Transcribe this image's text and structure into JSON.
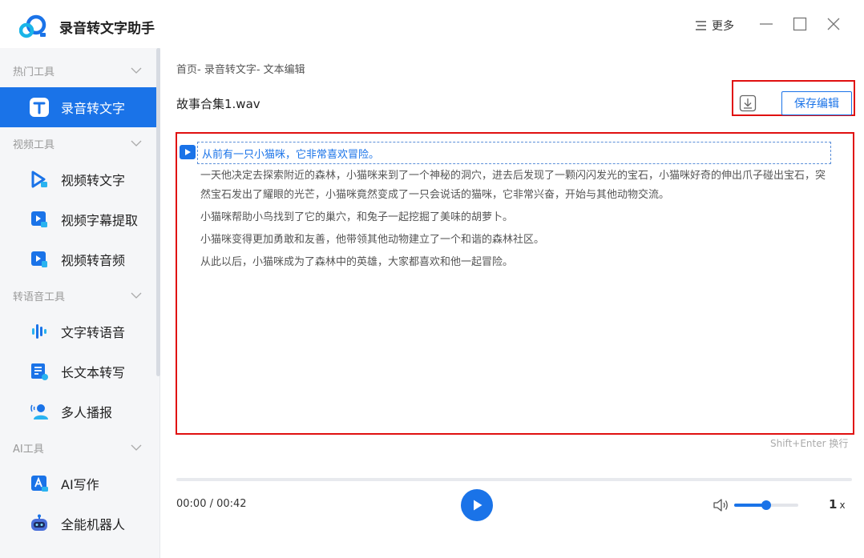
{
  "app": {
    "title": "录音转文字助手",
    "more_label": "更多"
  },
  "sidebar": {
    "sections": [
      {
        "label": "热门工具",
        "items": [
          {
            "label": "录音转文字",
            "icon": "text-t-icon",
            "active": true
          }
        ]
      },
      {
        "label": "视频工具",
        "items": [
          {
            "label": "视频转文字",
            "icon": "video-text-icon"
          },
          {
            "label": "视频字幕提取",
            "icon": "subtitle-extract-icon"
          },
          {
            "label": "视频转音频",
            "icon": "video-audio-icon"
          }
        ]
      },
      {
        "label": "转语音工具",
        "items": [
          {
            "label": "文字转语音",
            "icon": "voice-wave-icon"
          },
          {
            "label": "长文本转写",
            "icon": "long-text-icon"
          },
          {
            "label": "多人播报",
            "icon": "multi-speaker-icon"
          }
        ]
      },
      {
        "label": "AI工具",
        "items": [
          {
            "label": "AI写作",
            "icon": "ai-write-icon"
          },
          {
            "label": "全能机器人",
            "icon": "robot-icon"
          }
        ]
      }
    ]
  },
  "main": {
    "breadcrumb": "首页- 录音转文字- 文本编辑",
    "file_name": "故事合集1.wav",
    "save_label": "保存编辑",
    "paragraphs": [
      "从前有一只小猫咪，它非常喜欢冒险。",
      "一天他决定去探索附近的森林，小猫咪来到了一个神秘的洞穴，进去后发现了一颗闪闪发光的宝石，小猫咪好奇的伸出爪子碰出宝石，突然宝石发出了耀眼的光芒，小猫咪竟然变成了一只会说话的猫咪，它非常兴奋，开始与其他动物交流。",
      "小猫咪帮助小鸟找到了它的巢穴，和兔子一起挖掘了美味的胡萝卜。",
      "小猫咪变得更加勇敢和友善，他带领其他动物建立了一个和谐的森林社区。",
      "从此以后，小猫咪成为了森林中的英雄，大家都喜欢和他一起冒险。"
    ],
    "hint": "Shift+Enter 换行"
  },
  "player": {
    "time": "00:00 / 00:42",
    "progress": 0,
    "volume": 0.5,
    "speed": "1",
    "speed_suffix": "x"
  },
  "colors": {
    "accent": "#1a73e8",
    "highlight_border": "#e01010",
    "sidebar_bg": "#f5f6f8"
  }
}
